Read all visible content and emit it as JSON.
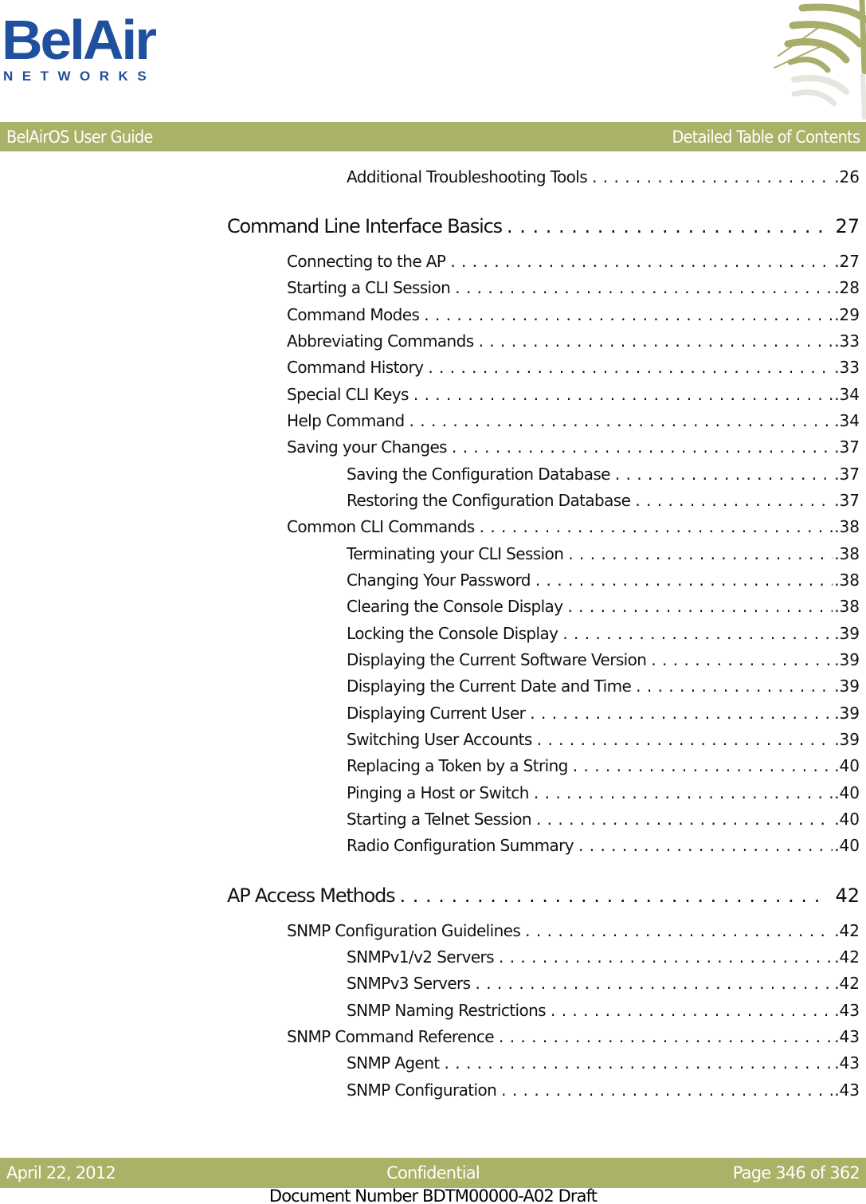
{
  "logo": {
    "wordmark": "BelAir",
    "subtitle": "NETWORKS",
    "color": "#1f4f9f"
  },
  "header": {
    "left": "BelAirOS User Guide",
    "right": "Detailed Table of Contents",
    "bar_color": "#a9b267"
  },
  "toc": [
    {
      "level": 2,
      "title": "Additional Troubleshooting Tools",
      "page": ".26"
    },
    {
      "level": 0,
      "title": "Command Line Interface Basics",
      "page": "27"
    },
    {
      "level": 1,
      "title": "Connecting to the AP",
      "page": ".27"
    },
    {
      "level": 1,
      "title": "Starting a CLI Session",
      "page": ".28"
    },
    {
      "level": 1,
      "title": "Command Modes",
      "page": ".29"
    },
    {
      "level": 1,
      "title": "Abbreviating Commands",
      "page": ".33"
    },
    {
      "level": 1,
      "title": "Command History",
      "page": ".33"
    },
    {
      "level": 1,
      "title": "Special CLI Keys",
      "page": ".34"
    },
    {
      "level": 1,
      "title": "Help Command",
      "page": ".34"
    },
    {
      "level": 1,
      "title": "Saving your Changes",
      "page": ".37"
    },
    {
      "level": 2,
      "title": "Saving the Configuration Database",
      "page": ".37"
    },
    {
      "level": 2,
      "title": "Restoring the Configuration Database",
      "page": ".37"
    },
    {
      "level": 1,
      "title": "Common CLI Commands",
      "page": ".38"
    },
    {
      "level": 2,
      "title": "Terminating your CLI Session",
      "page": ".38"
    },
    {
      "level": 2,
      "title": "Changing Your Password",
      "page": ".38"
    },
    {
      "level": 2,
      "title": "Clearing the Console Display",
      "page": ".38"
    },
    {
      "level": 2,
      "title": "Locking the Console Display",
      "page": ".39"
    },
    {
      "level": 2,
      "title": "Displaying the Current Software Version",
      "page": ".39"
    },
    {
      "level": 2,
      "title": "Displaying the Current Date and Time",
      "page": ".39"
    },
    {
      "level": 2,
      "title": "Displaying Current User",
      "page": ".39"
    },
    {
      "level": 2,
      "title": "Switching User Accounts",
      "page": ".39"
    },
    {
      "level": 2,
      "title": "Replacing a Token by a String",
      "page": ".40"
    },
    {
      "level": 2,
      "title": "Pinging a Host or Switch",
      "page": ".40"
    },
    {
      "level": 2,
      "title": "Starting a Telnet Session",
      "page": ".40"
    },
    {
      "level": 2,
      "title": "Radio Configuration Summary",
      "page": ".40"
    },
    {
      "level": 0,
      "title": "AP Access Methods",
      "page": "42"
    },
    {
      "level": 1,
      "title": "SNMP Configuration Guidelines",
      "page": ".42"
    },
    {
      "level": 2,
      "title": "SNMPv1/v2 Servers",
      "page": ".42"
    },
    {
      "level": 2,
      "title": "SNMPv3 Servers",
      "page": ".42"
    },
    {
      "level": 2,
      "title": "SNMP Naming Restrictions",
      "page": ".43"
    },
    {
      "level": 1,
      "title": "SNMP Command Reference",
      "page": ".43"
    },
    {
      "level": 2,
      "title": "SNMP Agent",
      "page": ".43"
    },
    {
      "level": 2,
      "title": "SNMP Configuration",
      "page": ".43"
    }
  ],
  "footer": {
    "date": "April 22, 2012",
    "classification": "Confidential",
    "page_info": "Page 346 of 362",
    "document_number": "Document Number BDTM00000-A02 Draft"
  }
}
